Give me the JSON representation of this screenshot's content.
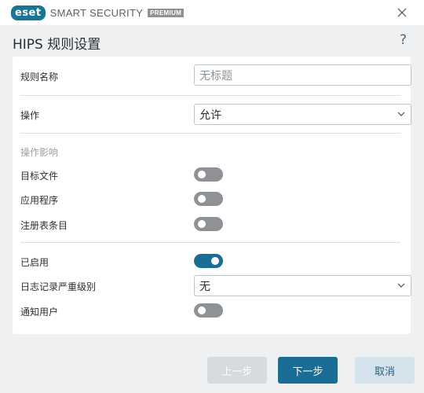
{
  "titlebar": {
    "logo_text": "eset",
    "product_name": "SMART SECURITY",
    "edition_badge": "PREMIUM",
    "close_icon": "close-icon"
  },
  "header": {
    "title": "HIPS 规则设置",
    "help_label": "?"
  },
  "form": {
    "rule_name_label": "规则名称",
    "rule_name_placeholder": "无标题",
    "action_label": "操作",
    "action_value": "允许",
    "affects_section": "操作影响",
    "target_files_label": "目标文件",
    "target_files_on": false,
    "applications_label": "应用程序",
    "applications_on": false,
    "registry_label": "注册表条目",
    "registry_on": false,
    "enabled_label": "已启用",
    "enabled_on": true,
    "log_severity_label": "日志记录严重级别",
    "log_severity_value": "无",
    "notify_user_label": "通知用户",
    "notify_user_on": false
  },
  "buttons": {
    "prev": "上一步",
    "next": "下一步",
    "cancel": "取消"
  },
  "colors": {
    "accent": "#1a6e96",
    "toggle_off": "#8e9297",
    "background": "#eef0f1"
  }
}
